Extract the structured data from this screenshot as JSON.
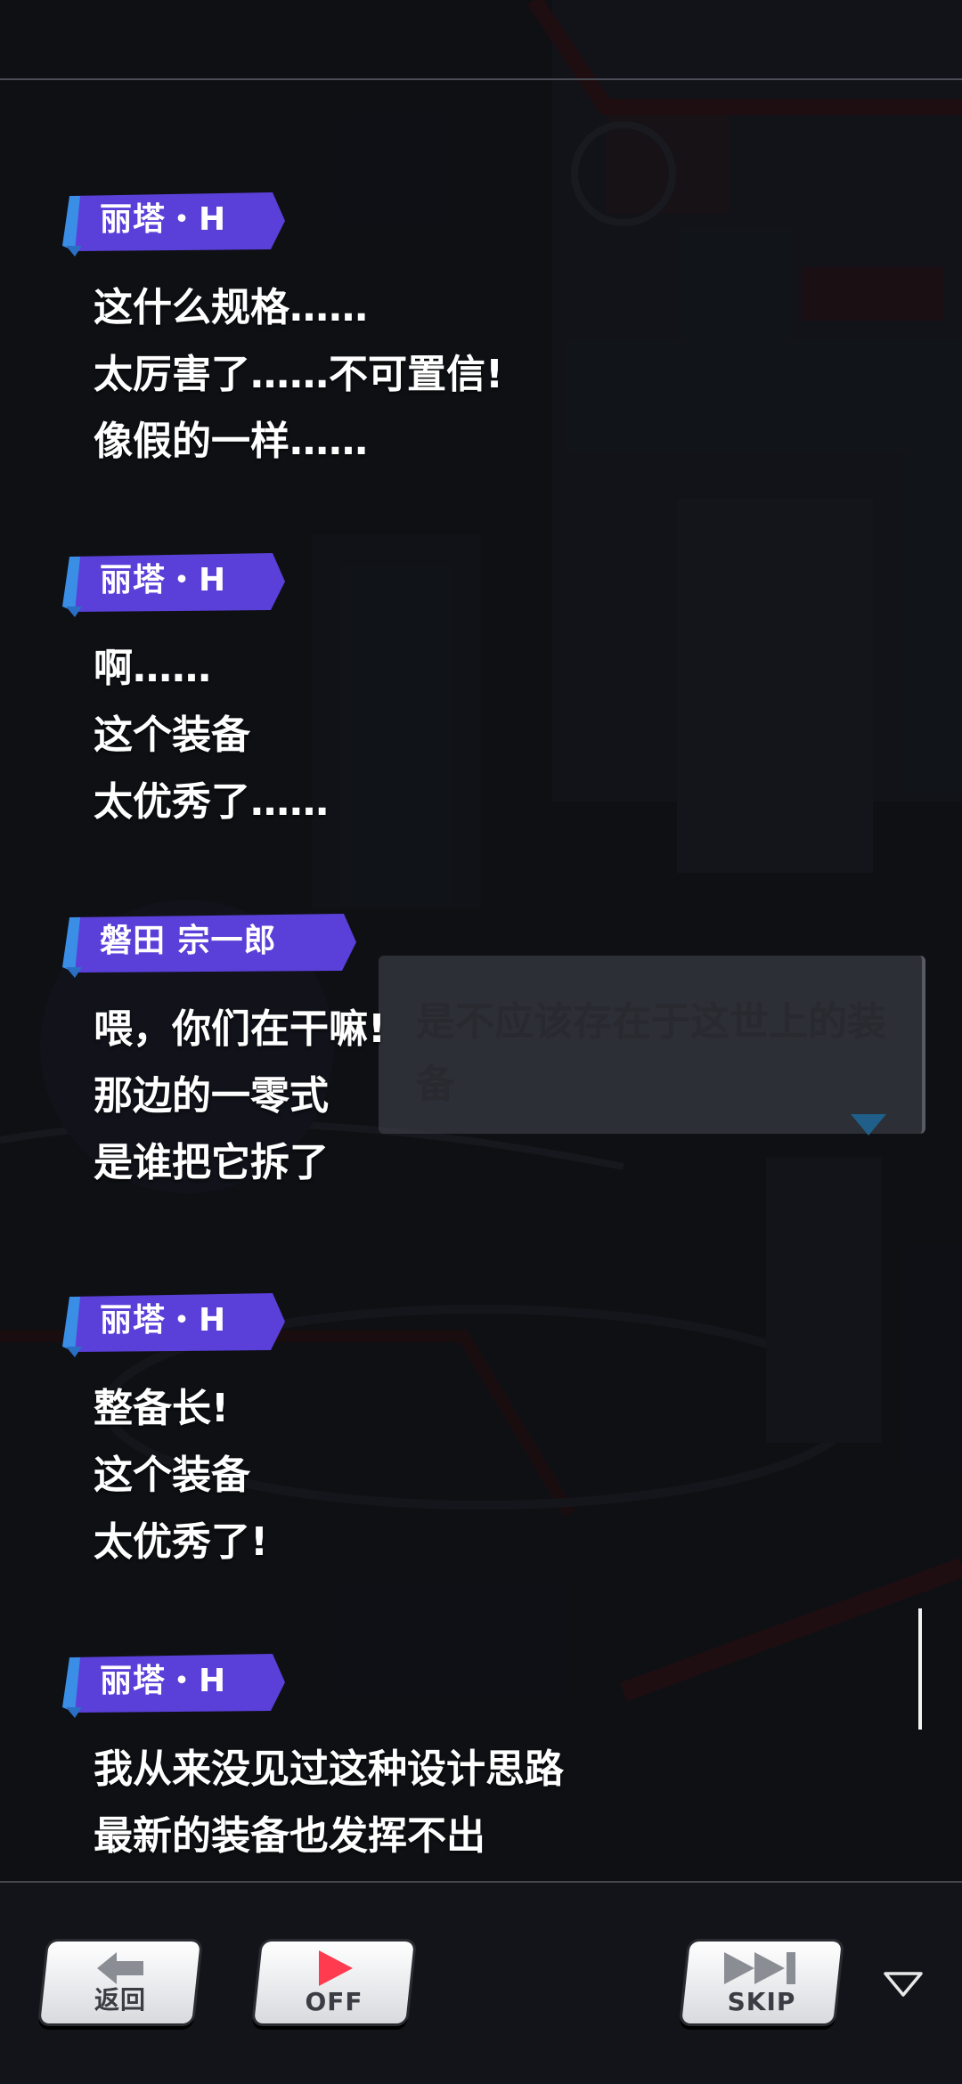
{
  "log": {
    "entries": [
      {
        "speaker": "丽塔・H",
        "lines": [
          "这什么规格……",
          "太厉害了……不可置信!",
          "像假的一样……"
        ]
      },
      {
        "speaker": "丽塔・H",
        "lines": [
          "啊……",
          "这个装备",
          "太优秀了……"
        ]
      },
      {
        "speaker": "磐田 宗一郎",
        "lines": [
          "喂，你们在干嘛!",
          "那边的一零式",
          "是谁把它拆了"
        ]
      },
      {
        "speaker": "丽塔・H",
        "lines": [
          "整备长!",
          "这个装备",
          "太优秀了!"
        ]
      },
      {
        "speaker": "丽塔・H",
        "lines": [
          "我从来没见过这种设计思路",
          "最新的装备也发挥不出"
        ]
      }
    ]
  },
  "background_dialog": {
    "text": "是不应该存在于这世上的装备"
  },
  "bottom_bar": {
    "back_label": "返回",
    "auto_label": "OFF",
    "skip_label": "SKIP"
  },
  "colors": {
    "name_tag": "#5a3fd8",
    "name_tag_accent": "#3a8ee6",
    "auto_icon": "#ff3b4f"
  },
  "icons": {
    "back": "back-arrow-icon",
    "auto": "play-icon",
    "skip": "fast-forward-icon",
    "menu": "triangle-down-icon"
  }
}
